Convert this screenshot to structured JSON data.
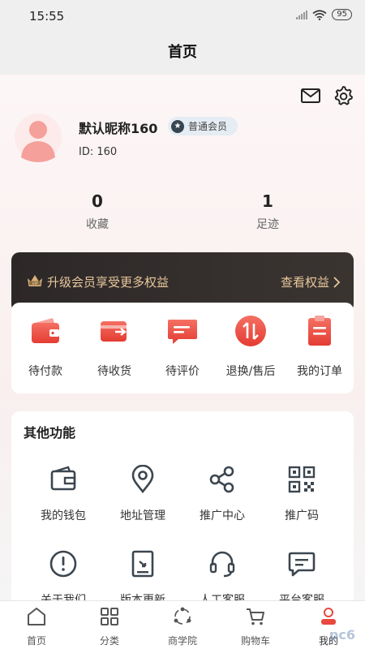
{
  "status": {
    "time": "15:55",
    "battery": "95"
  },
  "header": {
    "title": "首页"
  },
  "user": {
    "nickname": "默认昵称160",
    "badge": "普通会员",
    "id": "ID: 160"
  },
  "stats": [
    {
      "value": "0",
      "label": "收藏"
    },
    {
      "value": "1",
      "label": "足迹"
    }
  ],
  "vip": {
    "text": "升级会员享受更多权益",
    "link": "查看权益"
  },
  "orders": [
    {
      "label": "待付款",
      "icon": "wallet-icon"
    },
    {
      "label": "待收货",
      "icon": "truck-card-icon"
    },
    {
      "label": "待评价",
      "icon": "comment-icon"
    },
    {
      "label": "退换/售后",
      "icon": "exchange-icon"
    },
    {
      "label": "我的订单",
      "icon": "clipboard-icon"
    }
  ],
  "functions": {
    "title": "其他功能",
    "items": [
      {
        "label": "我的钱包",
        "icon": "wallet-outline-icon"
      },
      {
        "label": "地址管理",
        "icon": "location-pin-icon"
      },
      {
        "label": "推广中心",
        "icon": "share-icon"
      },
      {
        "label": "推广码",
        "icon": "qrcode-icon"
      },
      {
        "label": "关于我们",
        "icon": "info-icon"
      },
      {
        "label": "版本更新",
        "icon": "update-icon"
      },
      {
        "label": "人工客服",
        "icon": "headset-icon"
      },
      {
        "label": "平台客服",
        "icon": "message-icon"
      }
    ]
  },
  "tabs": [
    {
      "label": "首页",
      "icon": "home-icon"
    },
    {
      "label": "分类",
      "icon": "grid-icon"
    },
    {
      "label": "商学院",
      "icon": "academy-icon"
    },
    {
      "label": "购物车",
      "icon": "cart-icon"
    },
    {
      "label": "我的",
      "icon": "user-icon",
      "active": true
    }
  ],
  "colors": {
    "accent_red": "#e8483d",
    "vip_gold": "#e9c79b",
    "vip_bg": "#2f2a29"
  },
  "watermark": "pc6"
}
